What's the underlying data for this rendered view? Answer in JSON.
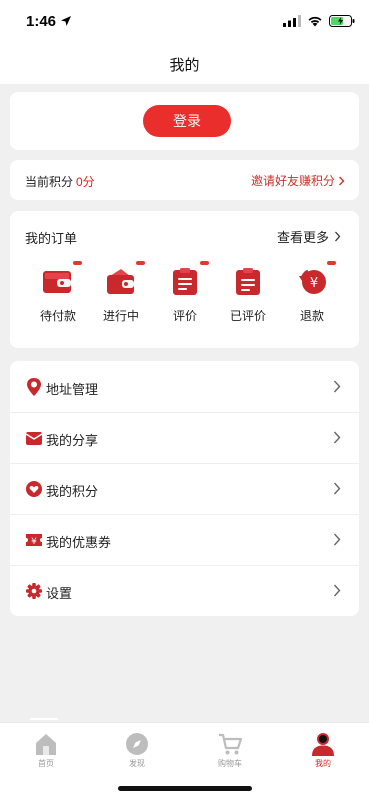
{
  "status_bar": {
    "time": "1:46"
  },
  "nav": {
    "title": "我的"
  },
  "login": {
    "button_label": "登录"
  },
  "points": {
    "label": "当前积分",
    "value": "0分",
    "invite_label": "邀请好友赚积分"
  },
  "orders": {
    "title": "我的订单",
    "more_label": "查看更多",
    "items": [
      {
        "label": "待付款",
        "icon": "wallet-icon"
      },
      {
        "label": "进行中",
        "icon": "wallet-open-icon"
      },
      {
        "label": "评价",
        "icon": "clipboard-icon"
      },
      {
        "label": "已评价",
        "icon": "clipboard-check-icon"
      },
      {
        "label": "退款",
        "icon": "refund-yen-icon"
      }
    ]
  },
  "menu": {
    "items": [
      {
        "label": "地址管理",
        "icon": "location-pin-icon"
      },
      {
        "label": "我的分享",
        "icon": "envelope-icon"
      },
      {
        "label": "我的积分",
        "icon": "heart-shield-icon"
      },
      {
        "label": "我的优惠券",
        "icon": "coupon-yen-icon"
      },
      {
        "label": "设置",
        "icon": "gear-icon"
      }
    ]
  },
  "tabs": [
    {
      "label": "首页",
      "icon": "home-icon",
      "active": false
    },
    {
      "label": "发现",
      "icon": "compass-icon",
      "active": false
    },
    {
      "label": "购物车",
      "icon": "cart-icon",
      "active": false
    },
    {
      "label": "我的",
      "icon": "user-icon",
      "active": true
    }
  ],
  "colors": {
    "accent": "#ea2e2b",
    "background": "#f1f0f0",
    "text": "#222222",
    "muted": "#9a9a9a"
  }
}
